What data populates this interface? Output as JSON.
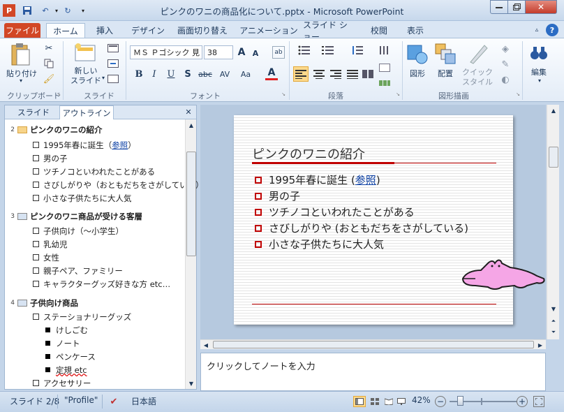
{
  "window": {
    "title": "ピンクのワニの商品化について.pptx - Microsoft PowerPoint",
    "app_icon": "powerpoint-icon"
  },
  "tabs": [
    "ファイル",
    "ホーム",
    "挿入",
    "デザイン",
    "画面切り替え",
    "アニメーション",
    "スライド ショー",
    "校閲",
    "表示"
  ],
  "ribbon": {
    "clipboard": {
      "paste": "貼り付け",
      "label": "クリップボード"
    },
    "slides": {
      "new_slide_line1": "新しい",
      "new_slide_line2": "スライド",
      "label": "スライド"
    },
    "font": {
      "name": "ＭＳ Ｐゴシック 見",
      "size": "38",
      "label": "フォント"
    },
    "paragraph": {
      "label": "段落"
    },
    "drawing": {
      "shape": "図形",
      "arrange": "配置",
      "quick_style_line1": "クイック",
      "quick_style_line2": "スタイル",
      "label": "図形描画"
    },
    "editing": {
      "label": "編集"
    }
  },
  "left_pane": {
    "tabs": [
      "スライド",
      "アウトライン"
    ],
    "slides": [
      {
        "num": "2",
        "title": "ピンクのワニの紹介",
        "current": true,
        "bullets": [
          "1995年春に誕生（",
          "男の子",
          "ツチノコといわれたことがある",
          "さびしがりや（おともだちをさがしている）",
          "小さな子供たちに大人気"
        ],
        "link": "参照",
        "after_link": "）"
      },
      {
        "num": "3",
        "title": "ピンクのワニ商品が受ける客層",
        "bullets": [
          "子供向け（～小学生）",
          "乳幼児",
          "女性",
          "親子ペア、ファミリー",
          "キャラクターグッズ好きな方 etc…"
        ]
      },
      {
        "num": "4",
        "title": "子供向け商品",
        "bullets": [
          "ステーショナリーグッズ"
        ],
        "sub": [
          "けしごむ",
          "ノート",
          "ペンケース",
          "定規 etc"
        ],
        "more": [
          "アクセサリー"
        ]
      }
    ]
  },
  "slide": {
    "title": "ピンクのワニの紹介",
    "bullets": [
      "1995年春に誕生 (",
      "男の子",
      "ツチノコといわれたことがある",
      "さびしがりや (おともだちをさがしている)",
      "小さな子供たちに大人気"
    ],
    "link": "参照",
    "after_link": ")"
  },
  "notes": {
    "placeholder": "クリックしてノートを入力"
  },
  "status": {
    "slide": "スライド 2/8",
    "theme": "\"Profile\"",
    "lang": "日本語",
    "zoom": "42%"
  },
  "colors": {
    "accent_red": "#c00000",
    "pink": "#f5a6e6",
    "file_tab": "#d24726"
  }
}
